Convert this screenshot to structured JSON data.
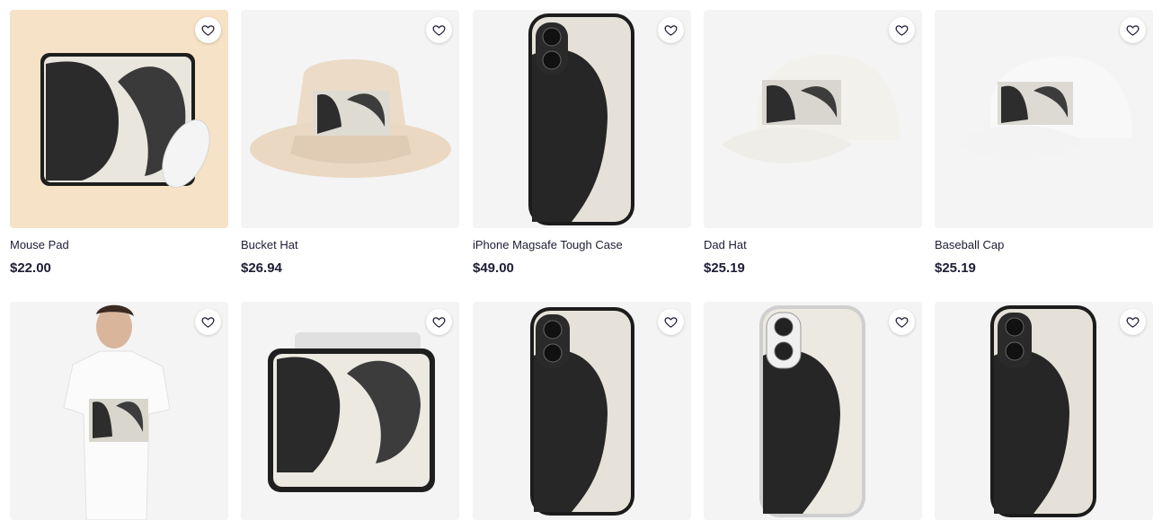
{
  "products_row1": [
    {
      "title": "Mouse Pad",
      "price": "$22.00",
      "icon": "mouse-pad"
    },
    {
      "title": "Bucket Hat",
      "price": "$26.94",
      "icon": "bucket-hat"
    },
    {
      "title": "iPhone Magsafe Tough Case",
      "price": "$49.00",
      "icon": "phone-case"
    },
    {
      "title": "Dad Hat",
      "price": "$25.19",
      "icon": "dad-hat"
    },
    {
      "title": "Baseball Cap",
      "price": "$25.19",
      "icon": "baseball-cap"
    }
  ],
  "products_row2": [
    {
      "icon": "t-shirt"
    },
    {
      "icon": "laptop-sleeve"
    },
    {
      "icon": "phone-case"
    },
    {
      "icon": "clear-phone-case"
    },
    {
      "icon": "phone-case"
    }
  ],
  "favorite_icon": "heart-outline-icon"
}
